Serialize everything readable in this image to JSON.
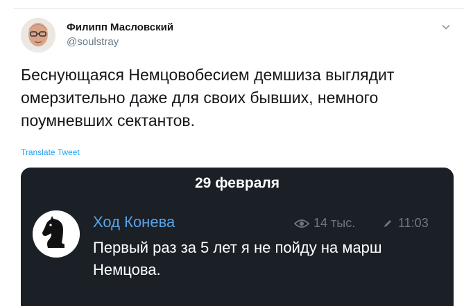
{
  "author": {
    "name": "Филипп Масловский",
    "handle": "@soulstray"
  },
  "tweet": {
    "text": "Беснующаяся Немцовобесием демшиза выглядит омерзительно даже для своих бывших, немного поумневших сектантов.",
    "translate_label": "Translate Tweet"
  },
  "embedded": {
    "date": "29 февраля",
    "channel_name": "Ход Конева",
    "views": "14 тыс.",
    "time": "11:03",
    "message": "Первый раз за 5 лет я не пойду на марш Немцова."
  },
  "icons": {
    "menu": "chevron-down-icon",
    "views": "eye-icon",
    "edited": "pencil-icon",
    "channel_avatar": "chess-knight-icon"
  },
  "colors": {
    "link": "#1da1f2",
    "channel_name": "#5aa3e6",
    "media_bg": "#1b2027",
    "meta_gray": "#6d7883"
  }
}
